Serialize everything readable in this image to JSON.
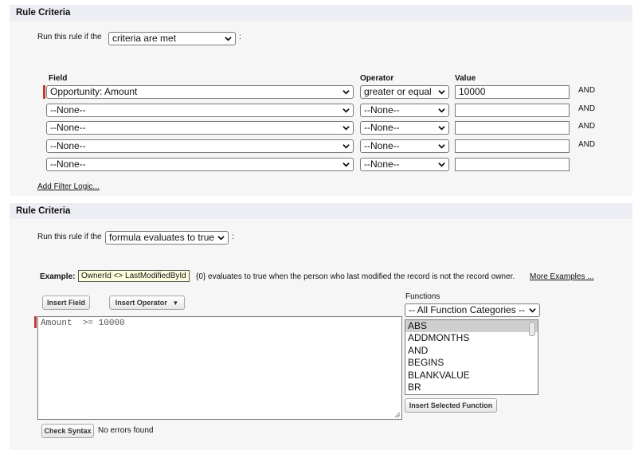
{
  "panel1": {
    "header": "Rule Criteria",
    "run_prefix": "Run this rule if the",
    "run_select": "criteria are met",
    "run_suffix": ":",
    "col_field": "Field",
    "col_operator": "Operator",
    "col_value": "Value",
    "rows": [
      {
        "field": "Opportunity: Amount",
        "operator": "greater or equal",
        "value": "10000",
        "conj": "AND"
      },
      {
        "field": "--None--",
        "operator": "--None--",
        "value": "",
        "conj": "AND"
      },
      {
        "field": "--None--",
        "operator": "--None--",
        "value": "",
        "conj": "AND"
      },
      {
        "field": "--None--",
        "operator": "--None--",
        "value": "",
        "conj": "AND"
      },
      {
        "field": "--None--",
        "operator": "--None--",
        "value": "",
        "conj": ""
      }
    ],
    "add_filter_logic": "Add Filter Logic..."
  },
  "panel2": {
    "header": "Rule Criteria",
    "run_prefix": "Run this rule if the",
    "run_select": "formula evaluates to true",
    "run_suffix": ":",
    "example_label": "Example:",
    "example_code": "OwnerId <> LastModifiedById",
    "example_text": "{0} evaluates to true when the person who last modified the record is not the record owner.",
    "more_examples": "More Examples ...",
    "insert_field": "Insert Field",
    "insert_operator": "Insert Operator",
    "formula": "Amount  >= 10000",
    "functions_label": "Functions",
    "function_category": "-- All Function Categories --",
    "functions": [
      "ABS",
      "ADDMONTHS",
      "AND",
      "BEGINS",
      "BLANKVALUE",
      "BR"
    ],
    "insert_selected_function": "Insert Selected Function",
    "check_syntax": "Check Syntax",
    "syntax_status": "No errors found"
  }
}
